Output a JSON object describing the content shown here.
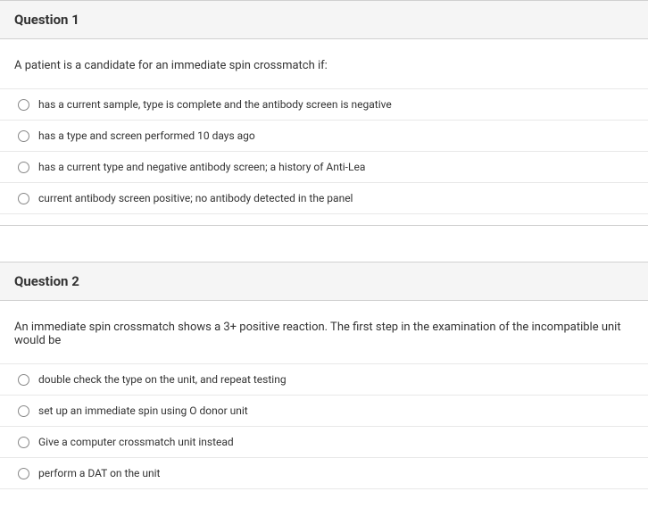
{
  "questions": [
    {
      "title": "Question 1",
      "prompt": "A patient is a candidate for an immediate spin crossmatch if:",
      "options": [
        "has a current sample, type is complete and the antibody screen is negative",
        "has a type and screen performed 10 days ago",
        "has a current type and negative antibody screen; a history of Anti-Lea",
        "current antibody screen positive; no antibody detected in the panel"
      ]
    },
    {
      "title": "Question 2",
      "prompt": "An immediate spin crossmatch shows a 3+ positive reaction. The first step in the examination of the incompatible unit would be",
      "options": [
        "double check the type on the unit, and repeat testing",
        "set up an immediate spin using O donor unit",
        "Give a computer crossmatch unit instead",
        "perform a DAT on the unit"
      ]
    }
  ]
}
